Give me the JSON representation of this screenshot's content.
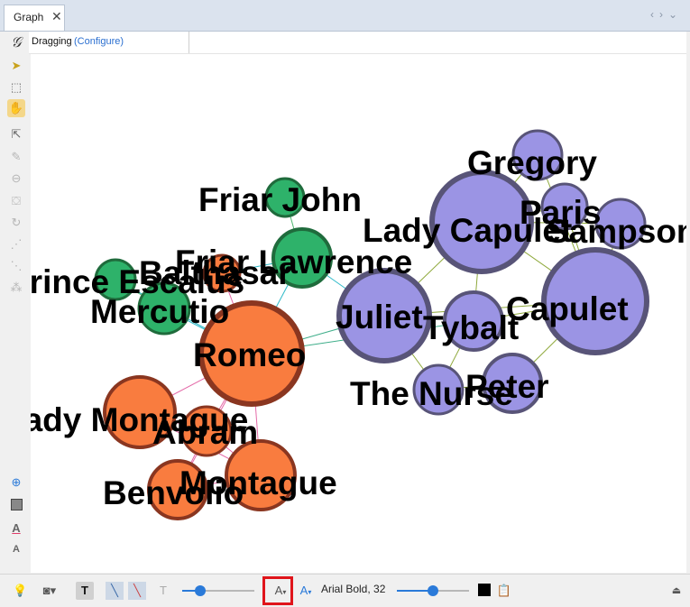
{
  "tab": {
    "title": "Graph",
    "close": "✕"
  },
  "propbar": {
    "mode": "Dragging",
    "configure": "(Configure)"
  },
  "toolbar_bottom": {
    "font": "Arial Bold, 32",
    "font_size_button": "A",
    "font_color_button": "A"
  },
  "sliders": {
    "edge_label_size": 0.25,
    "node_label_size": 0.5
  },
  "colors": {
    "orange": "#f97c3f",
    "orange_border": "#8a3620",
    "green": "#2eb26a",
    "green_border": "#1f6b3c",
    "purple": "#9b94e4",
    "purple_border": "#585478",
    "highlight": "#e0151b",
    "label_color": "#000000"
  },
  "graph": {
    "nodes": [
      {
        "id": "gregory",
        "label": "Gregory",
        "color": "purple"
      },
      {
        "id": "paris",
        "label": "Paris",
        "color": "purple"
      },
      {
        "id": "sampson",
        "label": "Sampson",
        "color": "purple"
      },
      {
        "id": "lady_capulet",
        "label": "Lady Capulet",
        "color": "purple"
      },
      {
        "id": "capulet",
        "label": "Capulet",
        "color": "purple"
      },
      {
        "id": "juliet",
        "label": "Juliet",
        "color": "purple"
      },
      {
        "id": "tybalt",
        "label": "Tybalt",
        "color": "purple"
      },
      {
        "id": "peter",
        "label": "Peter",
        "color": "purple"
      },
      {
        "id": "nurse",
        "label": "The Nurse",
        "color": "purple"
      },
      {
        "id": "friar_john",
        "label": "Friar John",
        "color": "green"
      },
      {
        "id": "friar_lawrence",
        "label": "Friar Lawrence",
        "color": "green"
      },
      {
        "id": "prince",
        "label": "Prince Escalus",
        "color": "green"
      },
      {
        "id": "mercutio",
        "label": "Mercutio",
        "color": "green"
      },
      {
        "id": "balthasar",
        "label": "Balthasar",
        "color": "orange"
      },
      {
        "id": "romeo",
        "label": "Romeo",
        "color": "orange"
      },
      {
        "id": "lady_montague",
        "label": "Lady Montague",
        "color": "orange"
      },
      {
        "id": "abram",
        "label": "Abram",
        "color": "orange"
      },
      {
        "id": "montague",
        "label": "Montague",
        "color": "orange"
      },
      {
        "id": "benvolio",
        "label": "Benvolio",
        "color": "orange"
      }
    ],
    "edges": [
      [
        "gregory",
        "lady_capulet"
      ],
      [
        "gregory",
        "capulet"
      ],
      [
        "paris",
        "capulet"
      ],
      [
        "paris",
        "lady_capulet"
      ],
      [
        "sampson",
        "capulet"
      ],
      [
        "sampson",
        "lady_capulet"
      ],
      [
        "lady_capulet",
        "capulet"
      ],
      [
        "lady_capulet",
        "juliet"
      ],
      [
        "lady_capulet",
        "tybalt"
      ],
      [
        "capulet",
        "juliet"
      ],
      [
        "capulet",
        "tybalt"
      ],
      [
        "capulet",
        "peter"
      ],
      [
        "juliet",
        "tybalt"
      ],
      [
        "juliet",
        "nurse"
      ],
      [
        "juliet",
        "romeo"
      ],
      [
        "juliet",
        "friar_lawrence"
      ],
      [
        "nurse",
        "peter"
      ],
      [
        "nurse",
        "tybalt"
      ],
      [
        "tybalt",
        "romeo"
      ],
      [
        "friar_john",
        "friar_lawrence"
      ],
      [
        "friar_lawrence",
        "romeo"
      ],
      [
        "friar_lawrence",
        "balthasar"
      ],
      [
        "prince",
        "mercutio"
      ],
      [
        "prince",
        "romeo"
      ],
      [
        "mercutio",
        "romeo"
      ],
      [
        "balthasar",
        "romeo"
      ],
      [
        "romeo",
        "lady_montague"
      ],
      [
        "romeo",
        "montague"
      ],
      [
        "romeo",
        "abram"
      ],
      [
        "romeo",
        "benvolio"
      ],
      [
        "lady_montague",
        "montague"
      ],
      [
        "lady_montague",
        "abram"
      ],
      [
        "abram",
        "montague"
      ],
      [
        "abram",
        "benvolio"
      ],
      [
        "benvolio",
        "montague"
      ]
    ]
  }
}
